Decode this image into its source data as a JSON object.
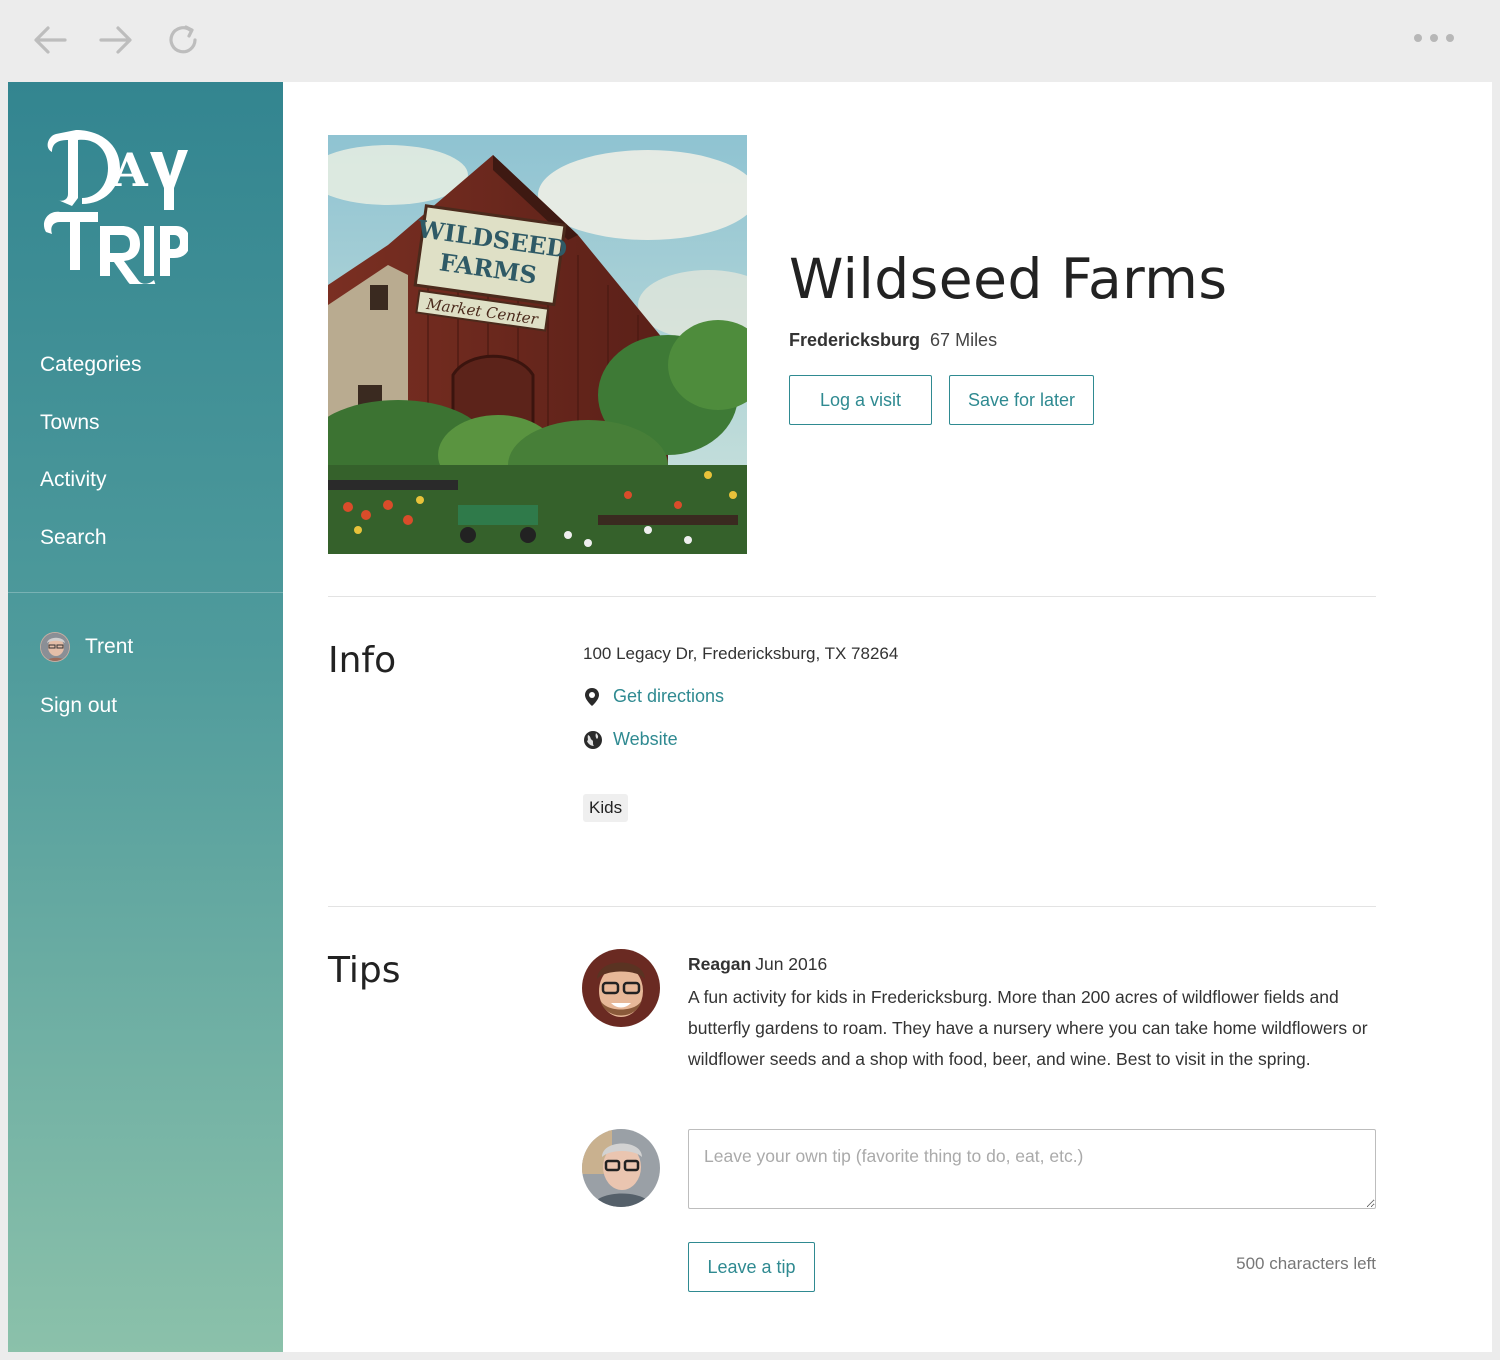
{
  "browser": {
    "back_icon": "arrow-left-icon",
    "forward_icon": "arrow-right-icon",
    "reload_icon": "reload-icon",
    "more_icon": "ellipsis-icon"
  },
  "sidebar": {
    "logo_text": "Day Trip",
    "nav": [
      {
        "label": "Categories"
      },
      {
        "label": "Towns"
      },
      {
        "label": "Activity"
      },
      {
        "label": "Search"
      }
    ],
    "user_name": "Trent",
    "sign_out": "Sign out"
  },
  "place": {
    "title": "Wildseed Farms",
    "town": "Fredericksburg",
    "distance": "67 Miles",
    "log_visit_label": "Log a visit",
    "save_label": "Save for later",
    "photo_sign": [
      "Wildseed",
      "Farms",
      "Market Center"
    ]
  },
  "info": {
    "heading": "Info",
    "address": "100 Legacy Dr, Fredericksburg, TX 78264",
    "directions_label": "Get directions",
    "website_label": "Website",
    "tags": [
      "Kids"
    ]
  },
  "tips": {
    "heading": "Tips",
    "items": [
      {
        "author": "Reagan",
        "date": "Jun 2016",
        "text": "A fun activity for kids in Fredericksburg. More than 200 acres of wildflower fields and butterfly gardens to roam. They have a nursery where you can take home wildflowers or wildflower seeds and a shop with food, beer, and wine. Best to visit in the spring."
      }
    ],
    "input_placeholder": "Leave your own tip (favorite thing to do, eat, etc.)",
    "submit_label": "Leave a tip",
    "chars_left": "500 characters left"
  },
  "colors": {
    "accent": "#2f8a91",
    "sidebar_top": "#338590",
    "sidebar_bottom": "#8bc1aa"
  }
}
